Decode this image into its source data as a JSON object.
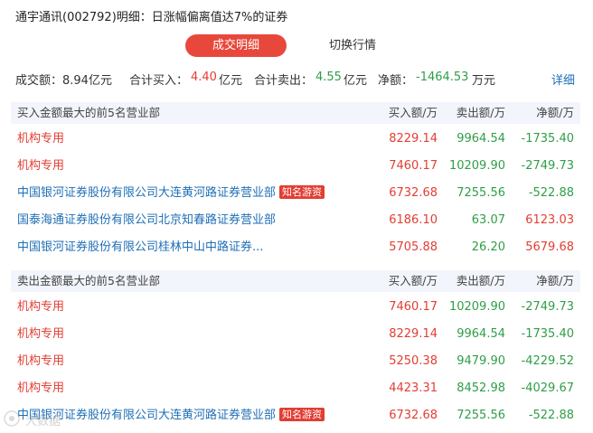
{
  "title": "通宇通讯(002792)明细：日涨幅偏离值达7%的证券",
  "tabs": {
    "active": "成交明细",
    "other": "切换行情"
  },
  "summary": {
    "turnover_label": "成交额：",
    "turnover_value": "8.94亿元",
    "buy_label": "合计买入：",
    "buy_value": "4.40",
    "buy_unit": "亿元",
    "sell_label": "合计卖出：",
    "sell_value": "4.55",
    "sell_unit": "亿元",
    "net_label": "净额：",
    "net_value": "-1464.53",
    "net_unit": "万元",
    "detail_link": "详细"
  },
  "columns": {
    "buy": "买入额/万",
    "sell": "卖出额/万",
    "net": "净额/万"
  },
  "buy_section": {
    "heading": "买入金额最大的前5名营业部",
    "rows": [
      {
        "name": "机构专用",
        "buy": "8229.14",
        "sell": "9964.54",
        "net": "-1735.40"
      },
      {
        "name": "机构专用",
        "buy": "7460.17",
        "sell": "10209.90",
        "net": "-2749.73"
      },
      {
        "name": "中国银河证券股份有限公司大连黄河路证券营业部",
        "badge": "知名游资",
        "buy": "6732.68",
        "sell": "7255.56",
        "net": "-522.88"
      },
      {
        "name": "国泰海通证券股份有限公司北京知春路证券营业部",
        "buy": "6186.10",
        "sell": "63.07",
        "net": "6123.03"
      },
      {
        "name": "中国银河证券股份有限公司桂林中山中路证券...",
        "buy": "5705.88",
        "sell": "26.20",
        "net": "5679.68"
      }
    ]
  },
  "sell_section": {
    "heading": "卖出金额最大的前5名营业部",
    "rows": [
      {
        "name": "机构专用",
        "buy": "7460.17",
        "sell": "10209.90",
        "net": "-2749.73"
      },
      {
        "name": "机构专用",
        "buy": "8229.14",
        "sell": "9964.54",
        "net": "-1735.40"
      },
      {
        "name": "机构专用",
        "buy": "5250.38",
        "sell": "9479.90",
        "net": "-4229.52"
      },
      {
        "name": "机构专用",
        "buy": "4423.31",
        "sell": "8452.98",
        "net": "-4029.67"
      },
      {
        "name": "中国银河证券股份有限公司大连黄河路证券营业部",
        "badge": "知名游资",
        "buy": "6732.68",
        "sell": "7255.56",
        "net": "-522.88"
      }
    ]
  },
  "watermark": "大数据"
}
